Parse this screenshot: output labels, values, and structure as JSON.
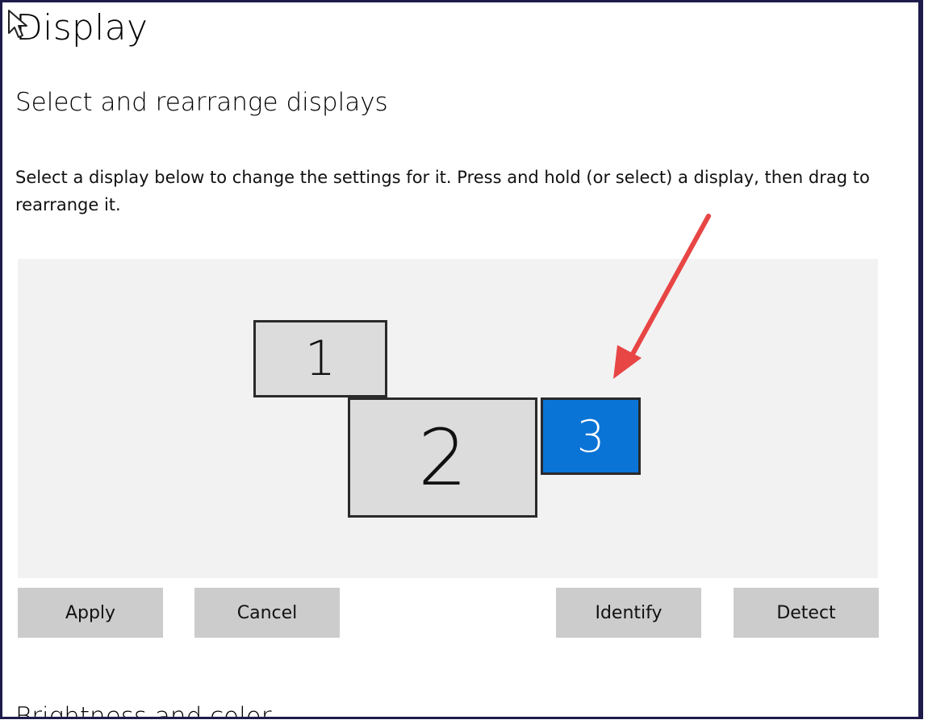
{
  "page": {
    "title": "Display"
  },
  "section": {
    "title": "Select and rearrange displays",
    "description": "Select a display below to change the settings for it. Press and hold (or select) a display, then drag to rearrange it."
  },
  "displays": [
    {
      "label": "1",
      "selected": false
    },
    {
      "label": "2",
      "selected": false
    },
    {
      "label": "3",
      "selected": true
    }
  ],
  "buttons": {
    "apply": "Apply",
    "cancel": "Cancel",
    "identify": "Identify",
    "detect": "Detect"
  },
  "next_section": {
    "title": "Brightness and color"
  },
  "colors": {
    "selected_display": "#0a74d6",
    "display": "#dcdcdc",
    "arrange_background": "#f2f2f2",
    "button": "#cccccc",
    "annotation_arrow": "#e84545"
  },
  "icons": {
    "cursor": "mouse-pointer-icon",
    "annotation": "red-arrow-icon"
  }
}
